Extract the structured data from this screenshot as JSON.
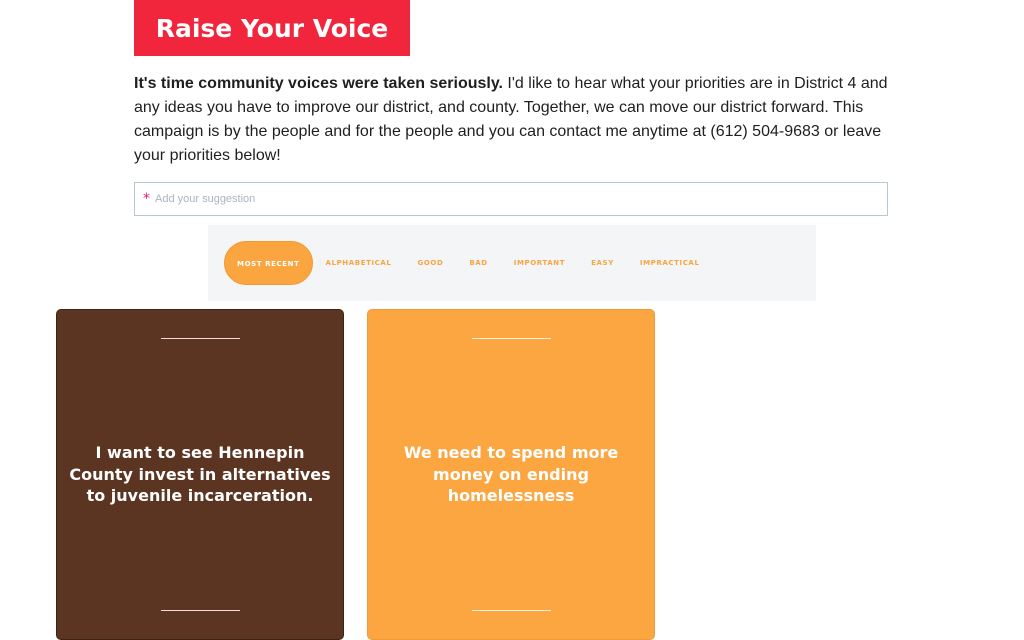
{
  "header": {
    "title": "Raise Your Voice"
  },
  "intro": {
    "lead": "It's time community voices were taken seriously.",
    "body": " I'd like to hear what your priorities are in District 4 and any ideas you have to improve our district, and county. Together, we can move our district forward.  This campaign is by the people and for the people and you can contact me anytime at (612) 504-9683 or leave your priorities below!"
  },
  "suggestion_input": {
    "required_marker": "*",
    "placeholder": "Add your suggestion",
    "value": ""
  },
  "filters": [
    {
      "label": "Most Recent",
      "active": true
    },
    {
      "label": "Alphabetical",
      "active": false
    },
    {
      "label": "Good",
      "active": false
    },
    {
      "label": "Bad",
      "active": false
    },
    {
      "label": "Important",
      "active": false
    },
    {
      "label": "Easy",
      "active": false
    },
    {
      "label": "Impractical",
      "active": false
    }
  ],
  "cards": [
    {
      "text": "I want to see Hennepin County invest in alternatives to juvenile incarceration.",
      "color": "#5b3521"
    },
    {
      "text": "We need to spend more money on ending homelessness",
      "color": "#fca642"
    }
  ],
  "colors": {
    "title_banner": "#f1263c",
    "accent_orange": "#fba541",
    "card_brown": "#5b3521",
    "required_marker": "#e0206e"
  }
}
